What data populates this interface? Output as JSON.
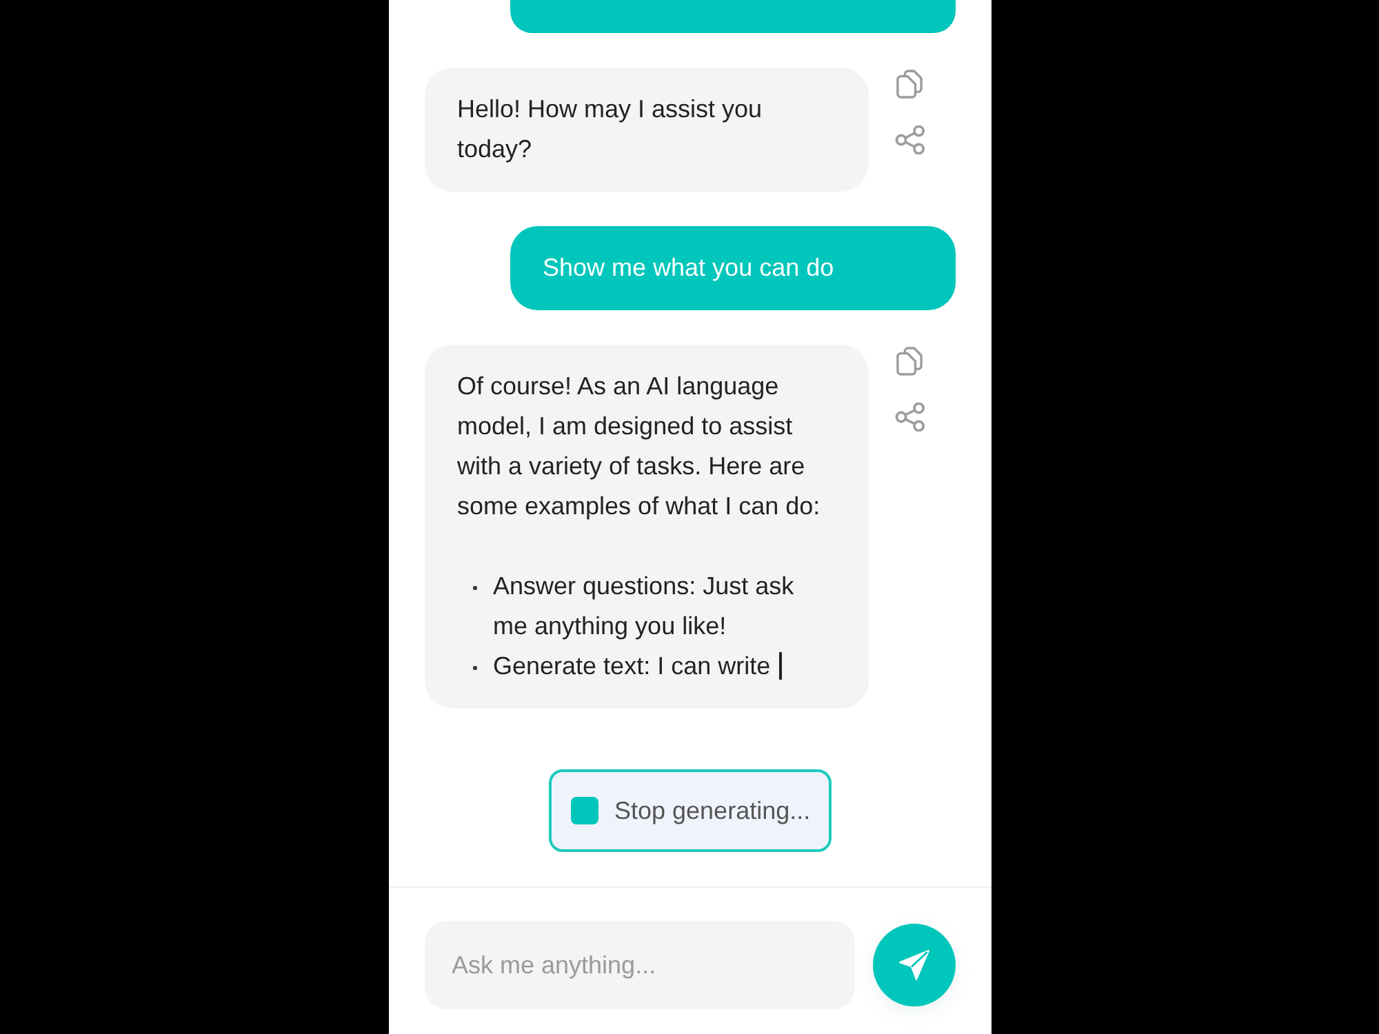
{
  "messages": [
    {
      "kind": "user"
    },
    {
      "kind": "assistant",
      "text": "Hello! How may I assist you today?",
      "actions": [
        {
          "kind": "copy"
        },
        {
          "kind": "share"
        }
      ]
    },
    {
      "kind": "user",
      "text": "Show me what you can do"
    },
    {
      "kind": "assistant",
      "text": "Of course! As an AI language model, I am designed to assist with a variety of tasks. Here are some examples of what I can do:",
      "list": [
        "Answer questions: Just ask me anything you like!",
        "Generate text: I can write"
      ],
      "streaming": true,
      "actions": [
        {
          "kind": "copy"
        },
        {
          "kind": "share"
        }
      ]
    }
  ],
  "stop_button": {
    "label": "Stop generating..."
  },
  "composer": {
    "placeholder": "Ask me anything..."
  }
}
